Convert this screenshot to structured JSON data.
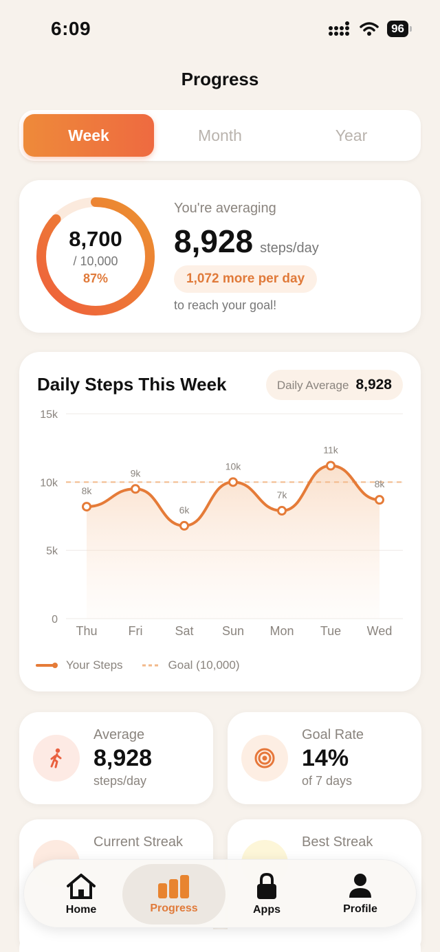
{
  "status": {
    "time": "6:09",
    "battery": "96"
  },
  "page": {
    "title": "Progress"
  },
  "segments": [
    {
      "label": "Week",
      "active": true
    },
    {
      "label": "Month",
      "active": false
    },
    {
      "label": "Year",
      "active": false
    }
  ],
  "summary": {
    "ring_value": "8,700",
    "ring_goal": "/ 10,000",
    "ring_percent": "87%",
    "ring_fraction": 0.87,
    "averaging_label": "You're averaging",
    "average_value": "8,928",
    "average_unit": "steps/day",
    "pill": "1,072 more per day",
    "reach": "to reach your goal!"
  },
  "chart_data": {
    "type": "line",
    "title": "Daily Steps This Week",
    "daily_average_label": "Daily Average",
    "daily_average_value": "8,928",
    "categories": [
      "Thu",
      "Fri",
      "Sat",
      "Sun",
      "Mon",
      "Tue",
      "Wed"
    ],
    "series": [
      {
        "name": "Your Steps",
        "values": [
          8200,
          9500,
          6800,
          10000,
          7900,
          11200,
          8700
        ]
      }
    ],
    "point_labels": [
      "8k",
      "9k",
      "6k",
      "10k",
      "7k",
      "11k",
      "8k"
    ],
    "goal": 10000,
    "goal_label": "Goal (10,000)",
    "ylim": [
      0,
      15000
    ],
    "yticks": [
      0,
      5000,
      10000,
      15000
    ],
    "ytick_labels": [
      "0",
      "5k",
      "10k",
      "15k"
    ],
    "grid": true,
    "legend": "bottom-left",
    "colors": {
      "line": "#e57b38",
      "goal": "#f2b98a"
    }
  },
  "stats": [
    {
      "label": "Average",
      "value": "8,928",
      "sub": "steps/day",
      "icon": "walking-icon"
    },
    {
      "label": "Goal Rate",
      "value": "14%",
      "sub": "of 7 days",
      "icon": "target-icon"
    },
    {
      "label": "Current Streak",
      "icon": "flame-icon"
    },
    {
      "label": "Best Streak",
      "icon": "trophy-icon"
    }
  ],
  "tabs": [
    {
      "label": "Home",
      "icon": "home-icon"
    },
    {
      "label": "Progress",
      "icon": "bar-chart-icon"
    },
    {
      "label": "Apps",
      "icon": "lock-icon"
    },
    {
      "label": "Profile",
      "icon": "person-icon"
    }
  ],
  "colors": {
    "accent": "#e07a3a",
    "background": "#f7f2ec"
  }
}
